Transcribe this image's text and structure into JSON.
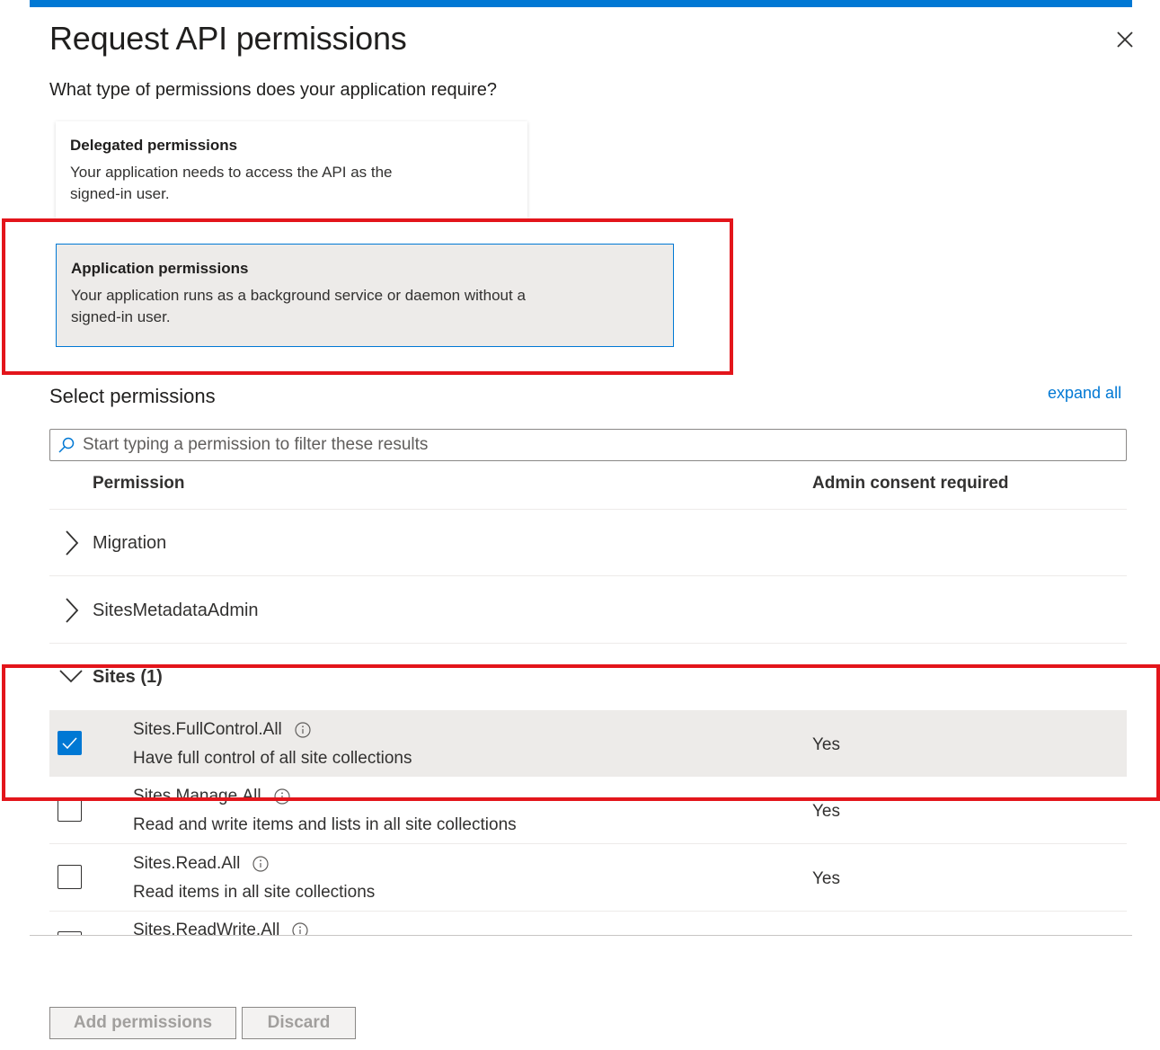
{
  "header": {
    "title": "Request API permissions",
    "accent_color": "#0078d4"
  },
  "question": "What type of permissions does your application require?",
  "permission_types": [
    {
      "title": "Delegated permissions",
      "description_line1": "Your application needs to access the API as the",
      "description_line2": "signed-in user.",
      "selected": false
    },
    {
      "title": "Application permissions",
      "description_line1": "Your application runs as a background service or daemon without a",
      "description_line2": "signed-in user.",
      "selected": true
    }
  ],
  "select": {
    "label": "Select permissions",
    "expand_all": "expand all",
    "search_placeholder": "Start typing a permission to filter these results"
  },
  "table": {
    "col_permission": "Permission",
    "col_admin": "Admin consent required"
  },
  "groups": [
    {
      "label": "Migration",
      "expanded": false
    },
    {
      "label": "SitesMetadataAdmin",
      "expanded": false
    },
    {
      "label": "Sites (1)",
      "expanded": true
    }
  ],
  "permissions": [
    {
      "name": "Sites.FullControl.All",
      "description": "Have full control of all site collections",
      "admin": "Yes",
      "checked": true
    },
    {
      "name": "Sites.Manage.All",
      "description": "Read and write items and lists in all site collections",
      "admin": "Yes",
      "checked": false
    },
    {
      "name": "Sites.Read.All",
      "description": "Read items in all site collections",
      "admin": "Yes",
      "checked": false
    },
    {
      "name": "Sites.ReadWrite.All",
      "description": "",
      "admin": "",
      "checked": false
    }
  ],
  "footer": {
    "add_label": "Add permissions",
    "discard_label": "Discard"
  },
  "highlight_color": "#e3151b"
}
